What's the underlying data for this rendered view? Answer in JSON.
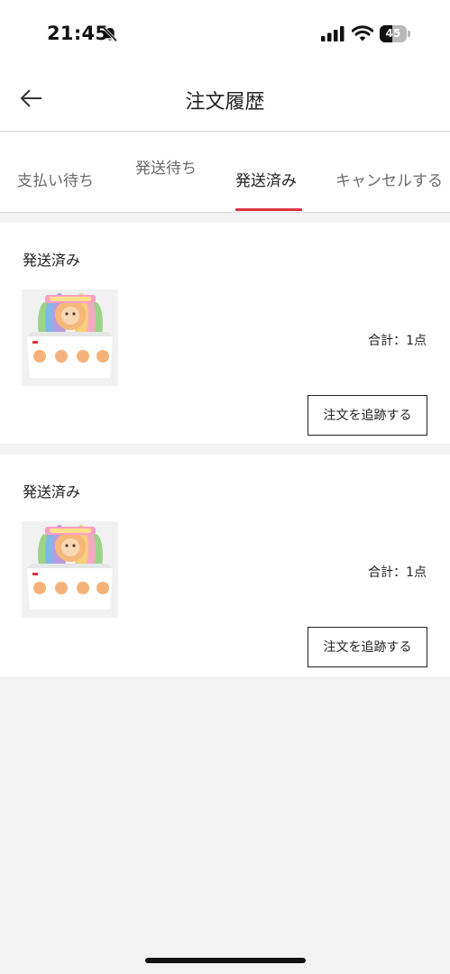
{
  "status_bar": {
    "time": "21:45",
    "battery": "45",
    "battery_level": 0.45,
    "icons": [
      "bell-muted-icon",
      "cellular-signal-icon",
      "wifi-icon",
      "battery-icon"
    ]
  },
  "header": {
    "back_icon": "arrow-left-icon",
    "title": "注文履歴"
  },
  "tabs": [
    {
      "label": "支払い待ち",
      "active": false
    },
    {
      "label": "発送待ち",
      "active": false
    },
    {
      "label": "発送済み",
      "active": true
    },
    {
      "label": "キャンセルする",
      "active": false
    }
  ],
  "orders": [
    {
      "status": "発送済み",
      "total": "合計：1点",
      "track_button": "注文を追跡する",
      "thumbnail_icon": "product-box-image"
    },
    {
      "status": "発送済み",
      "total": "合計：1点",
      "track_button": "注文を追跡する",
      "thumbnail_icon": "product-box-image"
    }
  ],
  "colors": {
    "accent": "#d9333f",
    "background": "#f3f3f3",
    "card": "#ffffff",
    "text": "#222222",
    "tab_inactive": "#6a6a6a"
  }
}
